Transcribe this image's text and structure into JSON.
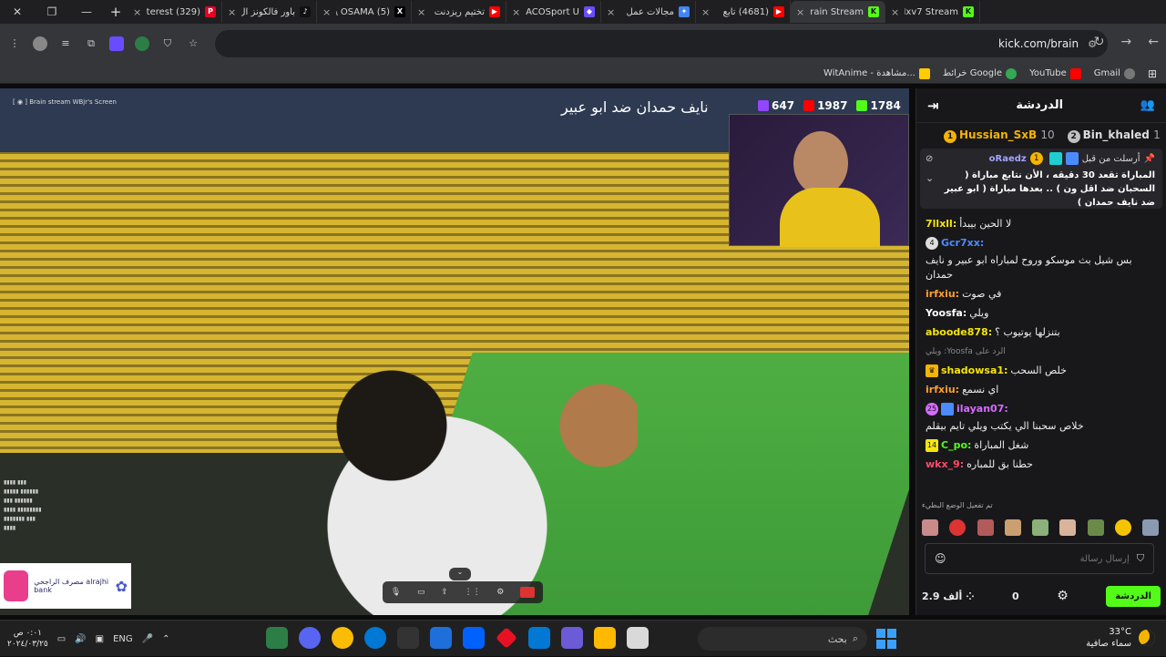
{
  "window_controls": {
    "close": "✕",
    "restore": "❐",
    "minimize": "—"
  },
  "tabs": [
    {
      "title": "(329) Pinterest",
      "fav": "P",
      "color": "#e60023"
    },
    {
      "title": "باور فالكونز ال",
      "fav": "♪",
      "color": "#111111"
    },
    {
      "title": "(5) X \\ OSAMA",
      "fav": "X",
      "color": "#000000"
    },
    {
      "title": "تختيم ريزدنت",
      "fav": "▶",
      "color": "#ff0000"
    },
    {
      "title": "JACOSport U",
      "fav": "◆",
      "color": "#6a4cff"
    },
    {
      "title": "مجالات عمل",
      "fav": "✦",
      "color": "#4285f4"
    },
    {
      "title": "(4681) تابع",
      "fav": "▶",
      "color": "#ff0000"
    },
    {
      "title": "Brain Stream",
      "fav": "K",
      "color": "#53fc18"
    },
    {
      "title": "Nxv7 Stream",
      "fav": "K",
      "color": "#53fc18"
    }
  ],
  "new_tab": "+",
  "address": {
    "url": "kick.com/brain"
  },
  "bookmarks": [
    {
      "label": "WitAnime - مشاهدة...",
      "color": "#ffcc00"
    },
    {
      "label": "خرائط Google",
      "color": "#34a853"
    },
    {
      "label": "YouTube",
      "color": "#ff0000"
    },
    {
      "label": "Gmail",
      "color": "#ea4335"
    }
  ],
  "stream": {
    "title": "نايف حمدان ضد ابو عبير",
    "meta": "[ ◉ ] Brain stream   WBjr's Screen",
    "stats": [
      {
        "value": "647",
        "color": "#9147ff"
      },
      {
        "value": "1987",
        "color": "#ff0000"
      },
      {
        "value": "1784",
        "color": "#53fc18"
      }
    ],
    "bank_label": "مصرف الراجحي\nalrajhi bank"
  },
  "chat": {
    "title": "الدردشة",
    "leaders": [
      {
        "rank": "1",
        "name": "Hussian_SxB",
        "count": "10",
        "color": "#f5b400"
      },
      {
        "rank": "2",
        "name": "Bin_khaled",
        "count": "1",
        "color": "#c0c0c0"
      }
    ],
    "pinned": {
      "label": "أرسلت من قبل",
      "user": "oRaedz",
      "text": "المباراة تقعد 30 دقيقه ، الأن نتابع مباراة ( السحبان ضد اقل ون ) .. بعدها مباراة ( ابو عبير ضد نايف حمدان )"
    },
    "messages": [
      {
        "user": "7llxll:",
        "text": "لا الحين بيبدأ",
        "color": "#f5e50b"
      },
      {
        "user": "Gcr7xx:",
        "text": "بس شيل بث موسكو وروح لمباراه ابو عبير و نايف حمدان",
        "color": "#4b8bff",
        "badge": "4"
      },
      {
        "user": "irfxiu:",
        "text": "في صوت",
        "color": "#ff9f2e"
      },
      {
        "user": "Yoosfa:",
        "text": "ويلي",
        "color": "#ffffff"
      },
      {
        "user": "aboode878:",
        "text": "بتنزلها يوتيوب ؟",
        "color": "#f5e50b"
      },
      {
        "user": "Yoosfa",
        "text": "الرد على  Yoosfa: ويلي",
        "color": "#888888",
        "reply": true
      },
      {
        "user": "shadowsa1:",
        "text": "خلص السحب",
        "color": "#f5e50b",
        "badge": "♛"
      },
      {
        "user": "irfxiu:",
        "text": "اي نسمع",
        "color": "#ff9f2e"
      },
      {
        "user": "ilayan07:",
        "text": "خلاص سحبنا الي يكتب ويلي تايم بيقلم",
        "color": "#d46cff",
        "badge": "25"
      },
      {
        "user": "C_po:",
        "text": "شغل المباراة",
        "color": "#53fc18",
        "badge": "14"
      },
      {
        "user": "wkx_9:",
        "text": "حطنا بق للمباره",
        "color": "#ff4a6a"
      }
    ],
    "slow_mode": "تم تفعيل الوضع البطيء",
    "input_placeholder": "إرسال رسالة",
    "viewers": "2.9 ألف",
    "points": "0",
    "send_label": "الدردشة"
  },
  "taskbar": {
    "time": "٠:٠١ ص",
    "date": "٢٠٢٤/٠٣/٢٥",
    "lang": "ENG",
    "search_label": "بحث",
    "temp": "33°C",
    "weather": "سماء صافية",
    "apps": [
      "#2d7d46",
      "#5865f2",
      "#fbbc05",
      "#0078d4",
      "#333333",
      "#1e6fd9",
      "#0061fe",
      "#e81123",
      "#0078d4",
      "#6b5bd6",
      "#ffb900",
      "#d9d9d9",
      "#c9733a"
    ]
  }
}
